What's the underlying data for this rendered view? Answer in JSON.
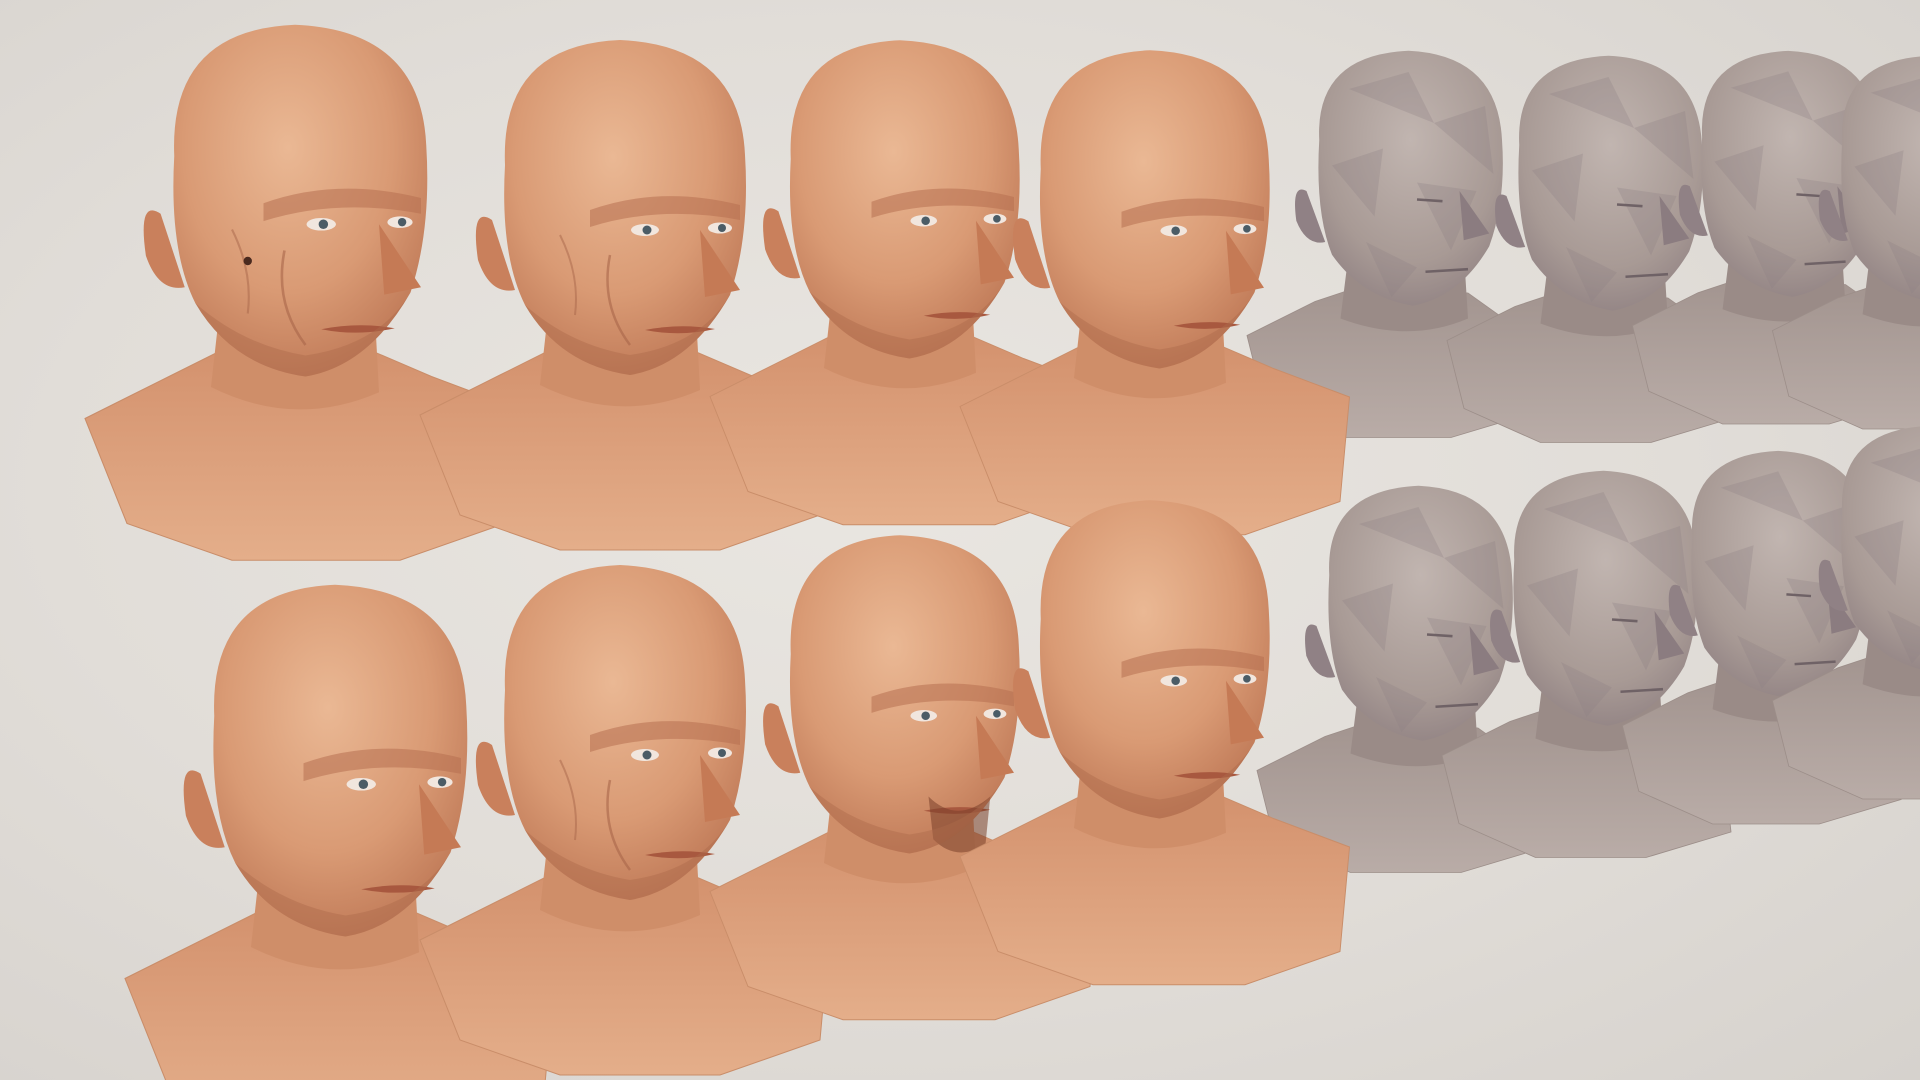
{
  "scene": {
    "background_color": "#e4e0db",
    "rows": [
      {
        "textured_heads": [
          {
            "variant": "older-man-wide-face",
            "has_mole": true
          },
          {
            "variant": "elderly-man-wrinkled"
          },
          {
            "variant": "middle-aged-man-frown"
          },
          {
            "variant": "young-man-narrow-face"
          }
        ],
        "untextured_heads": [
          {
            "variant": "lowpoly-base-1"
          },
          {
            "variant": "lowpoly-base-2"
          },
          {
            "variant": "lowpoly-base-3"
          },
          {
            "variant": "lowpoly-base-4-cropped"
          }
        ]
      },
      {
        "textured_heads": [
          {
            "variant": "stern-man"
          },
          {
            "variant": "elderly-man-smiling"
          },
          {
            "variant": "bearded-man-goatee"
          },
          {
            "variant": "young-man-square-jaw"
          }
        ],
        "untextured_heads": [
          {
            "variant": "lowpoly-base-5"
          },
          {
            "variant": "lowpoly-base-6"
          },
          {
            "variant": "lowpoly-base-7"
          },
          {
            "variant": "lowpoly-base-8-cropped"
          }
        ]
      }
    ],
    "colors": {
      "skin_base": "#d99a74",
      "skin_light": "#e8b28e",
      "skin_shadow": "#b8704f",
      "clay_base": "#a89a95",
      "clay_light": "#bcb0ab",
      "clay_shadow": "#85767a"
    }
  }
}
